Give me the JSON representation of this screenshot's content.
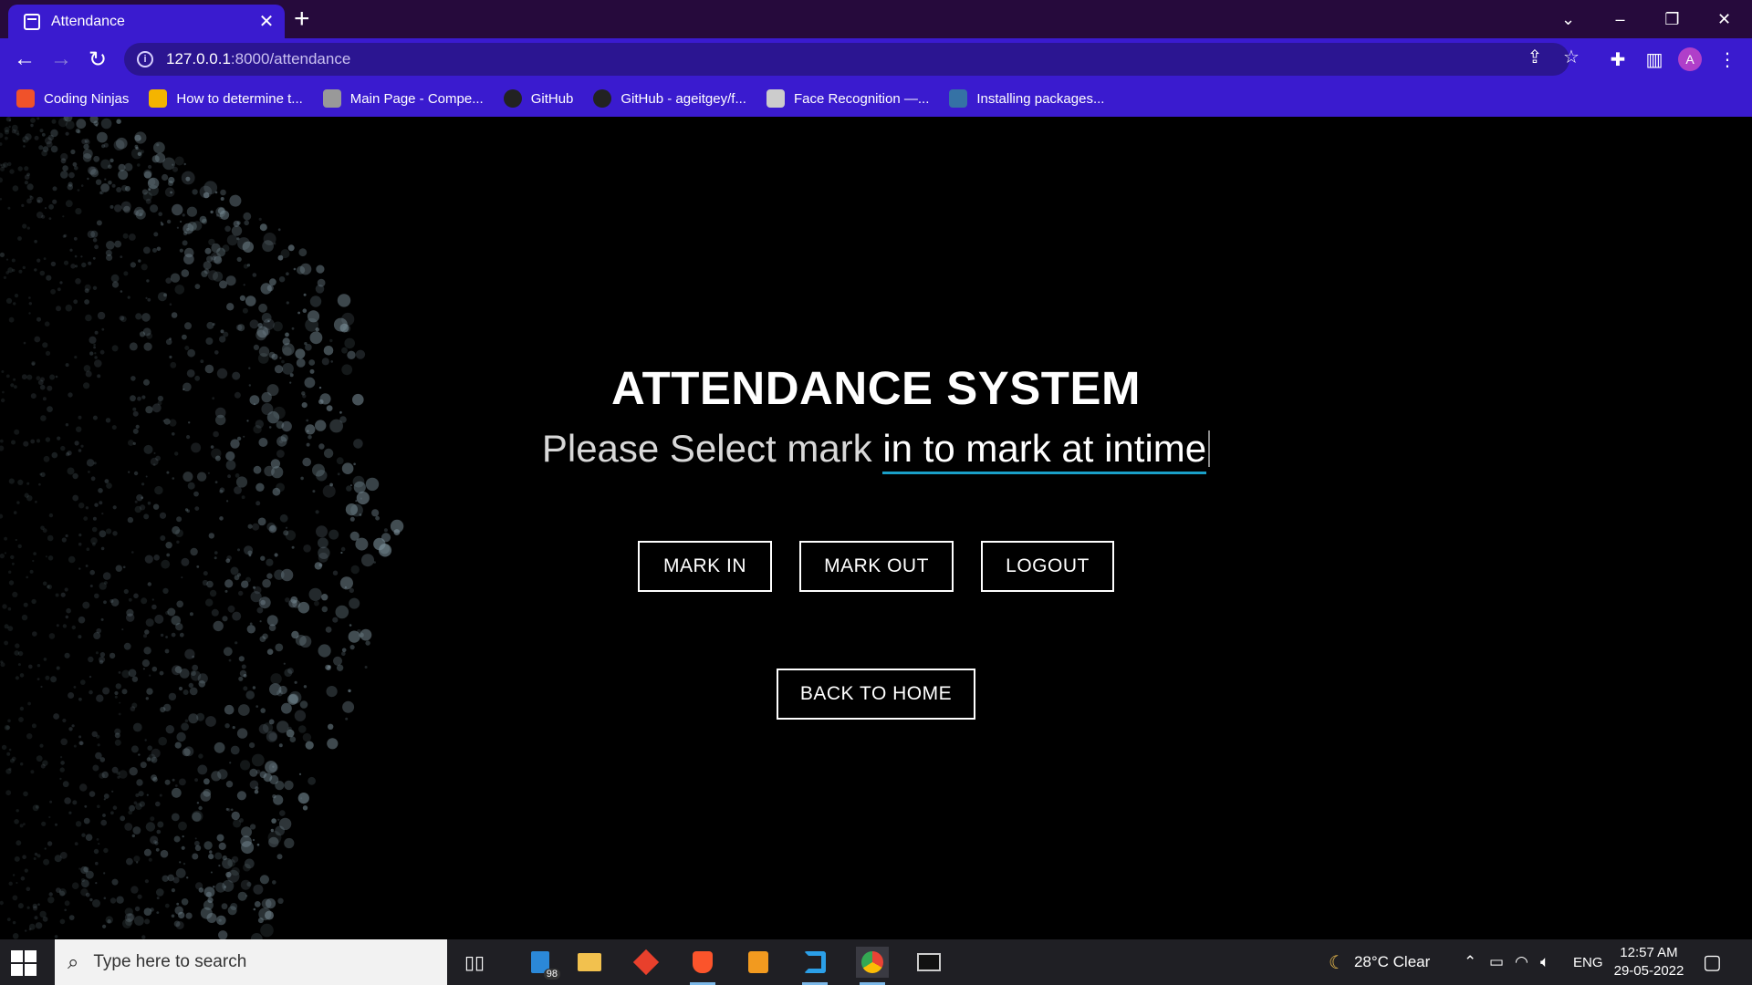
{
  "browser": {
    "tab_title": "Attendance",
    "url_host": "127.0.0.1",
    "url_path": ":8000/attendance",
    "profile_initial": "A",
    "bookmarks": [
      {
        "label": "Coding Ninjas",
        "icon": "coding-ninjas-icon",
        "color": "#f0522a"
      },
      {
        "label": "How to determine t...",
        "icon": "bar-chart-icon",
        "color": "#f4b400"
      },
      {
        "label": "Main Page - Compe...",
        "icon": "mascot-icon",
        "color": "#999999"
      },
      {
        "label": "GitHub",
        "icon": "github-icon",
        "color": "#222222"
      },
      {
        "label": "GitHub - ageitgey/f...",
        "icon": "github-icon",
        "color": "#222222"
      },
      {
        "label": "Face Recognition —...",
        "icon": "book-icon",
        "color": "#cccccc"
      },
      {
        "label": "Installing packages...",
        "icon": "python-icon",
        "color": "#3572a5"
      }
    ]
  },
  "page": {
    "title": "ATTENDANCE SYSTEM",
    "subtitle_static": "Please Select mark ",
    "subtitle_typed": "in to mark at intime",
    "buttons": {
      "mark_in": "MARK IN",
      "mark_out": "MARK OUT",
      "logout": "LOGOUT",
      "back_home": "BACK TO HOME"
    },
    "accent_color": "#1aa0c8"
  },
  "taskbar": {
    "search_placeholder": "Type here to search",
    "mail_badge": "98",
    "weather": "28°C  Clear",
    "language": "ENG",
    "time": "12:57 AM",
    "date": "29-05-2022"
  }
}
